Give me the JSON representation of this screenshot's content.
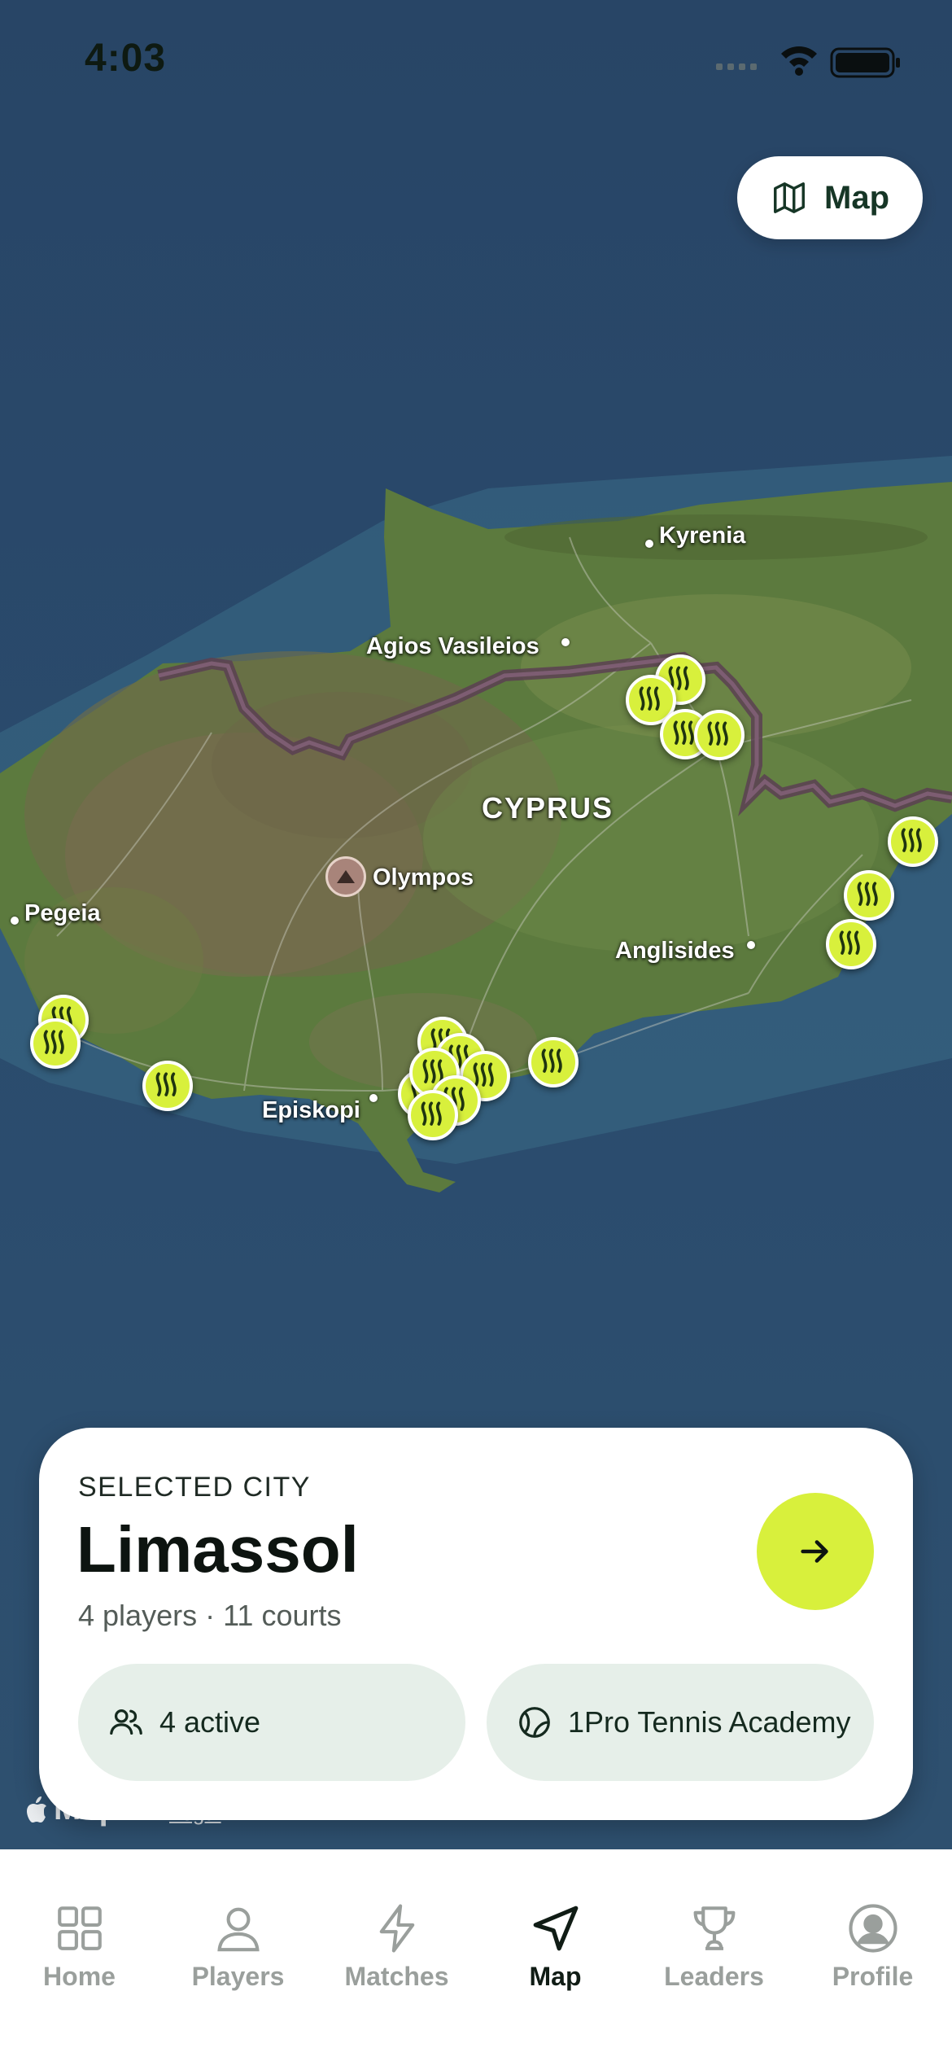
{
  "status_bar": {
    "time": "4:03"
  },
  "map_toggle": {
    "label": "Map",
    "icon": "map-icon"
  },
  "map": {
    "places": [
      {
        "id": "kyrenia",
        "name": "Kyrenia"
      },
      {
        "id": "agios-vasileios",
        "name": "Agios Vasileios"
      },
      {
        "id": "cyprus",
        "name": "CYPRUS"
      },
      {
        "id": "olympos",
        "name": "Olympos"
      },
      {
        "id": "pegeia",
        "name": "Pegeia"
      },
      {
        "id": "anglisides",
        "name": "Anglisides"
      },
      {
        "id": "episkopi",
        "name": "Episkopi"
      }
    ],
    "pin_icon": "tennis-ball-icon",
    "attribution": "Maps",
    "legal": "Legal"
  },
  "city_card": {
    "eyebrow": "SELECTED CITY",
    "city": "Limassol",
    "summary": "4 players · 11 courts",
    "go_icon": "arrow-right-icon",
    "chips": [
      {
        "icon": "users-icon",
        "label": "4 active"
      },
      {
        "icon": "tennis-ball-icon",
        "label": "1Pro Tennis Academy"
      }
    ]
  },
  "tabs": [
    {
      "id": "home",
      "label": "Home",
      "icon": "grid-icon",
      "active": false
    },
    {
      "id": "players",
      "label": "Players",
      "icon": "person-icon",
      "active": false
    },
    {
      "id": "matches",
      "label": "Matches",
      "icon": "lightning-icon",
      "active": false
    },
    {
      "id": "map",
      "label": "Map",
      "icon": "navigation-arrow-icon",
      "active": true
    },
    {
      "id": "leaders",
      "label": "Leaders",
      "icon": "trophy-icon",
      "active": false
    },
    {
      "id": "profile",
      "label": "Profile",
      "icon": "profile-circle-icon",
      "active": false
    }
  ],
  "colors": {
    "accent": "#d8f03c",
    "text_dark": "#0d1410",
    "chip_bg": "#e6efe9",
    "tab_inactive": "#9a9f9c"
  }
}
